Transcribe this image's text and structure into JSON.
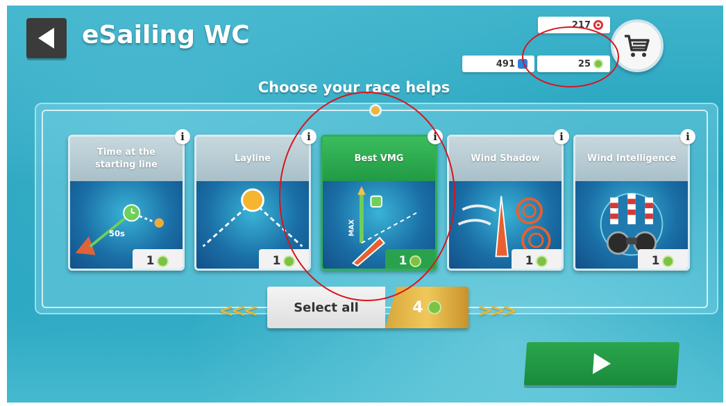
{
  "header": {
    "title": "eSailing WC",
    "subtitle": "Choose your race helps"
  },
  "currency": {
    "top_value": "217",
    "left_value": "491",
    "right_value": "25",
    "colors": {
      "red": "#d9323a",
      "blue": "#2f7fd6",
      "green": "#7dc242"
    }
  },
  "cards": [
    {
      "title": "Time at the starting line",
      "cost": "1",
      "art_label": "50s",
      "selected": false,
      "icon": "timer-icon"
    },
    {
      "title": "Layline",
      "cost": "1",
      "selected": false,
      "icon": "sun-icon"
    },
    {
      "title": "Best VMG",
      "cost": "1",
      "art_label": "MAX",
      "selected": true,
      "icon": "boat-icon"
    },
    {
      "title": "Wind Shadow",
      "cost": "1",
      "selected": false,
      "icon": "wind-swirl-icon"
    },
    {
      "title": "Wind Intelligence",
      "cost": "1",
      "selected": false,
      "icon": "binoculars-icon"
    }
  ],
  "info_glyph": "i",
  "select_all": {
    "label": "Select all",
    "cost": "4"
  },
  "decor": {
    "arrows_left": "<<<",
    "arrows_right": ">>>"
  },
  "colors": {
    "accent_green": "#2aa64c",
    "gold": "#e8b734",
    "annotation_red": "#d8141c"
  }
}
